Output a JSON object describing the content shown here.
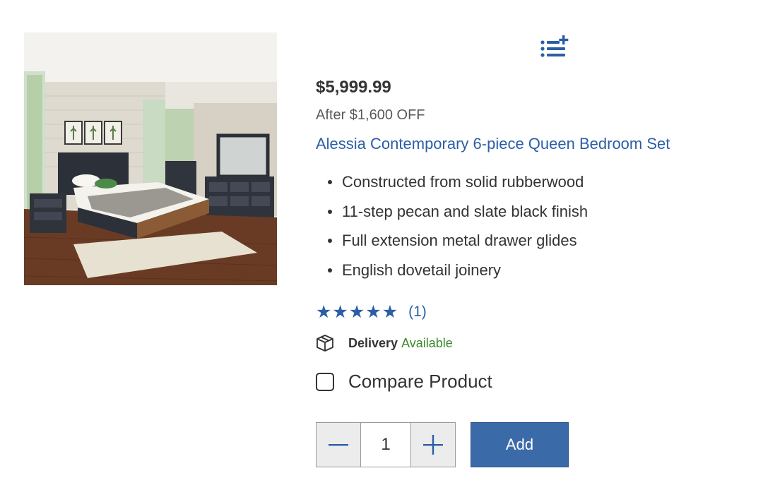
{
  "product": {
    "price": "$5,999.99",
    "discount": "After $1,600 OFF",
    "title": "Alessia Contemporary 6-piece Queen Bedroom Set",
    "features": [
      "Constructed from solid rubberwood",
      "11-step pecan and slate black finish",
      "Full extension metal drawer glides",
      "English dovetail joinery"
    ],
    "rating": {
      "stars": "★★★★★",
      "value": 5,
      "max": 5,
      "review_count": "(1)"
    },
    "delivery": {
      "label": "Delivery",
      "status": "Available"
    },
    "compare": {
      "label": "Compare Product",
      "checked": false
    },
    "quantity": {
      "value": "1"
    },
    "add_button_label": "Add"
  },
  "icons": {
    "list": "add-to-list-icon",
    "delivery": "package-box-icon",
    "minus": "minus-icon",
    "plus": "plus-icon"
  },
  "colors": {
    "accent_blue": "#2a5fa6",
    "button_blue": "#3b6aa8",
    "available_green": "#3a8a2a",
    "text_dark": "#333333"
  }
}
